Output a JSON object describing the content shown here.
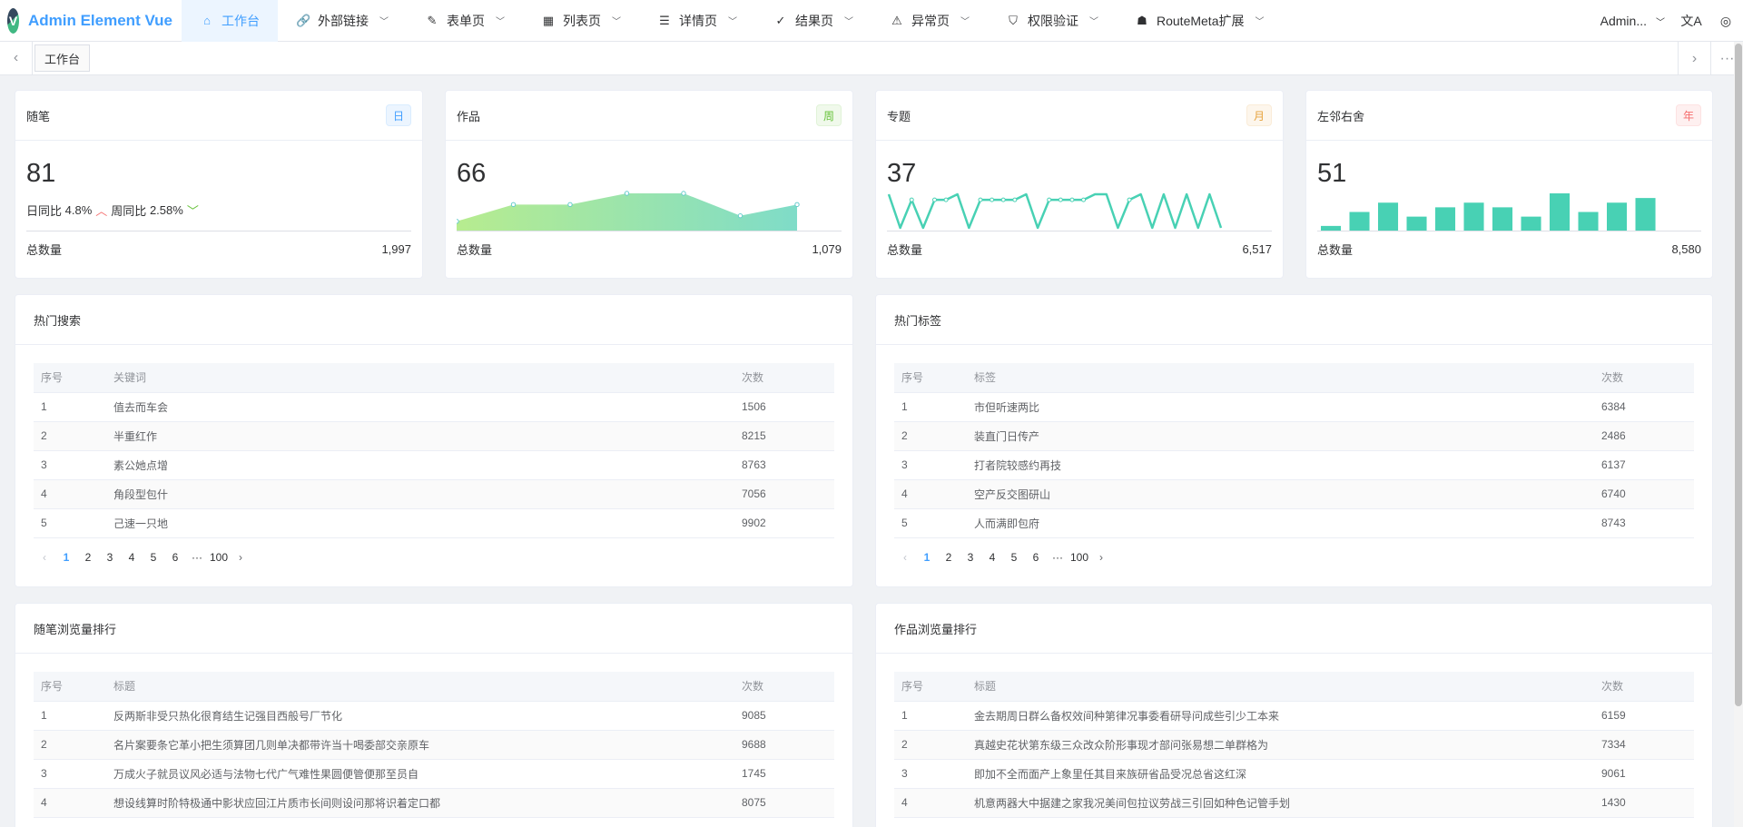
{
  "brand": {
    "title": "Admin Element Vue",
    "logo_letter": "V"
  },
  "nav": [
    {
      "label": "工作台",
      "icon": "⌂",
      "icon_name": "home-icon"
    },
    {
      "label": "外部链接",
      "icon": "🔗",
      "icon_name": "link-icon"
    },
    {
      "label": "表单页",
      "icon": "✎",
      "icon_name": "form-icon"
    },
    {
      "label": "列表页",
      "icon": "▦",
      "icon_name": "table-icon"
    },
    {
      "label": "详情页",
      "icon": "☰",
      "icon_name": "detail-icon"
    },
    {
      "label": "结果页",
      "icon": "✓",
      "icon_name": "result-icon"
    },
    {
      "label": "异常页",
      "icon": "⚠",
      "icon_name": "warning-icon"
    },
    {
      "label": "权限验证",
      "icon": "⛉",
      "icon_name": "shield-icon"
    },
    {
      "label": "RouteMeta扩展",
      "icon": "☗",
      "icon_name": "route-icon"
    }
  ],
  "user": {
    "name": "Admin..."
  },
  "tabs": {
    "items": [
      "工作台"
    ]
  },
  "stats": [
    {
      "title": "随笔",
      "tag": "日",
      "value": "81",
      "foot_label": "总数量",
      "foot_value": "1,997",
      "trend": {
        "day_label": "日同比",
        "day_value": "4.8%",
        "week_label": "周同比",
        "week_value": "2.58%"
      }
    },
    {
      "title": "作品",
      "tag": "周",
      "value": "66",
      "foot_label": "总数量",
      "foot_value": "1,079"
    },
    {
      "title": "专题",
      "tag": "月",
      "value": "37",
      "foot_label": "总数量",
      "foot_value": "6,517"
    },
    {
      "title": "左邻右舍",
      "tag": "年",
      "value": "51",
      "foot_label": "总数量",
      "foot_value": "8,580"
    }
  ],
  "colors": {
    "accent": "#409eff",
    "chart_teal": "#48d1b4",
    "up": "#f56c6c",
    "down": "#67c23a"
  },
  "chart_data": [
    {
      "type": "area",
      "title": "",
      "x": [
        0,
        1,
        2,
        3,
        4,
        5,
        6
      ],
      "values": [
        1,
        4,
        4,
        6,
        6,
        2,
        4
      ]
    },
    {
      "type": "line",
      "title": "",
      "x": [
        0,
        1,
        2,
        3,
        4,
        5,
        6,
        7,
        8,
        9,
        10,
        11,
        12,
        13,
        14,
        15,
        16,
        17,
        18,
        19,
        20,
        21,
        22,
        23,
        24,
        25,
        26,
        27,
        28,
        29
      ],
      "values": [
        6,
        0,
        5,
        0,
        5,
        5,
        6,
        0,
        5,
        5,
        5,
        5,
        6,
        0,
        5,
        5,
        5,
        5,
        6,
        6,
        0,
        5,
        6,
        0,
        6,
        0,
        6,
        0,
        6,
        0
      ]
    },
    {
      "type": "bar",
      "title": "",
      "categories": [
        "1",
        "2",
        "3",
        "4",
        "5",
        "6",
        "7",
        "8",
        "9",
        "10",
        "11",
        "12"
      ],
      "values": [
        1,
        4,
        6,
        3,
        5,
        6,
        5,
        3,
        8,
        4,
        6,
        7
      ]
    }
  ],
  "panels": {
    "hot_search": {
      "title": "热门搜索",
      "columns": [
        "序号",
        "关键词",
        "次数"
      ],
      "rows": [
        [
          "1",
          "值去而车会",
          "1506"
        ],
        [
          "2",
          "半重红作",
          "8215"
        ],
        [
          "3",
          "素公她点增",
          "8763"
        ],
        [
          "4",
          "角段型包什",
          "7056"
        ],
        [
          "5",
          "己速一只地",
          "9902"
        ]
      ],
      "pages": [
        "1",
        "2",
        "3",
        "4",
        "5",
        "6",
        "···",
        "100"
      ]
    },
    "hot_tags": {
      "title": "热门标签",
      "columns": [
        "序号",
        "标签",
        "次数"
      ],
      "rows": [
        [
          "1",
          "市但听速两比",
          "6384"
        ],
        [
          "2",
          "装直门日传产",
          "2486"
        ],
        [
          "3",
          "打者院较感约再技",
          "6137"
        ],
        [
          "4",
          "空产反交图研山",
          "6740"
        ],
        [
          "5",
          "人而满即包府",
          "8743"
        ]
      ],
      "pages": [
        "1",
        "2",
        "3",
        "4",
        "5",
        "6",
        "···",
        "100"
      ]
    },
    "essay_rank": {
      "title": "随笔浏览量排行",
      "columns": [
        "序号",
        "标题",
        "次数"
      ],
      "rows": [
        [
          "1",
          "反两斯非受只热化很育结生记强目西般号厂节化",
          "9085"
        ],
        [
          "2",
          "名片案要条它革小把生须算团几则单决都带许当十喝委部交亲原车",
          "9688"
        ],
        [
          "3",
          "万成火子就员议风必适与法物七代广气难性果圆便管便那至员自",
          "1745"
        ],
        [
          "4",
          "想设线算时阶特极通中影状应回江片质市长间则设问那将识着定口都",
          "8075"
        ]
      ]
    },
    "works_rank": {
      "title": "作品浏览量排行",
      "columns": [
        "序号",
        "标题",
        "次数"
      ],
      "rows": [
        [
          "1",
          "金去期周日群么备权效间种第律况事委看研导问成些引少工本来",
          "6159"
        ],
        [
          "2",
          "真越史花状第东级三众改众阶形事现才部问张易想二单群格为",
          "7334"
        ],
        [
          "3",
          "即加不全而面产上象里任其目来族研省品受况总省这红深",
          "9061"
        ],
        [
          "4",
          "机意两器大中据建之家我况美间包拉议劳战三引回如种色记管手划",
          "1430"
        ]
      ]
    }
  }
}
